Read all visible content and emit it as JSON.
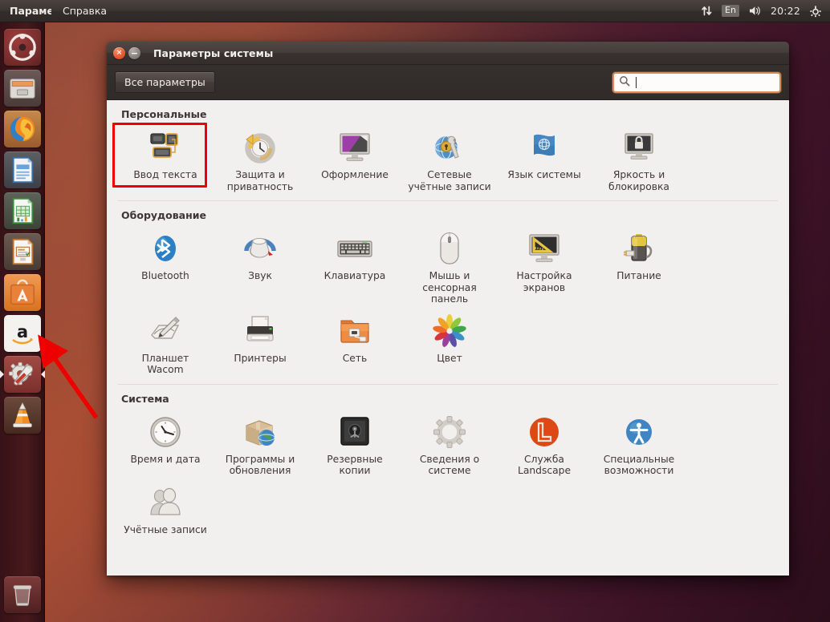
{
  "panel": {
    "menu_app": "Парамет",
    "menu_help": "Справка",
    "network_icon": "network-arrows-icon",
    "keyboard_layout": "En",
    "volume_icon": "volume-icon",
    "clock": "20:22",
    "session_icon": "session-gear-icon"
  },
  "launcher": {
    "items": [
      {
        "name": "dash-home",
        "icon": "ubuntu-logo-icon",
        "state": ""
      },
      {
        "name": "files",
        "icon": "file-manager-icon",
        "state": ""
      },
      {
        "name": "firefox",
        "icon": "firefox-icon",
        "state": ""
      },
      {
        "name": "libreoffice-writer",
        "icon": "writer-icon",
        "state": ""
      },
      {
        "name": "libreoffice-calc",
        "icon": "calc-icon",
        "state": ""
      },
      {
        "name": "libreoffice-impress",
        "icon": "impress-icon",
        "state": ""
      },
      {
        "name": "ubuntu-software-center",
        "icon": "software-center-icon",
        "state": ""
      },
      {
        "name": "amazon",
        "icon": "amazon-icon",
        "state": ""
      },
      {
        "name": "system-settings",
        "icon": "system-settings-icon",
        "state": "active"
      },
      {
        "name": "vlc",
        "icon": "vlc-cone-icon",
        "state": ""
      }
    ],
    "trash": {
      "name": "trash",
      "icon": "trash-icon"
    }
  },
  "window": {
    "title": "Параметры системы",
    "close_label": "×",
    "minimize_label": "−",
    "toolbar": {
      "all_settings_label": "Все параметры",
      "search_placeholder": "",
      "search_value": "",
      "search_icon": "search-icon"
    }
  },
  "sections": [
    {
      "title": "Персональные",
      "tiles": [
        {
          "label": "Ввод текста",
          "icon": "text-entry-icon",
          "highlighted": true
        },
        {
          "label": "Защита и приватность",
          "icon": "privacy-icon",
          "highlighted": false
        },
        {
          "label": "Оформление",
          "icon": "appearance-icon",
          "highlighted": false
        },
        {
          "label": "Сетевые учётные записи",
          "icon": "online-accounts-icon",
          "highlighted": false
        },
        {
          "label": "Язык системы",
          "icon": "language-flag-icon",
          "highlighted": false
        },
        {
          "label": "Яркость и блокировка",
          "icon": "brightness-lock-icon",
          "highlighted": false
        }
      ]
    },
    {
      "title": "Оборудование",
      "tiles": [
        {
          "label": "Bluetooth",
          "icon": "bluetooth-icon",
          "highlighted": false
        },
        {
          "label": "Звук",
          "icon": "sound-icon",
          "highlighted": false
        },
        {
          "label": "Клавиатура",
          "icon": "keyboard-icon",
          "highlighted": false
        },
        {
          "label": "Мышь и сенсорная панель",
          "icon": "mouse-touchpad-icon",
          "highlighted": false
        },
        {
          "label": "Настройка экранов",
          "icon": "displays-icon",
          "highlighted": false
        },
        {
          "label": "Питание",
          "icon": "power-battery-icon",
          "highlighted": false
        },
        {
          "label": "Планшет Wacom",
          "icon": "wacom-tablet-icon",
          "highlighted": false
        },
        {
          "label": "Принтеры",
          "icon": "printer-icon",
          "highlighted": false
        },
        {
          "label": "Сеть",
          "icon": "network-folder-icon",
          "highlighted": false
        },
        {
          "label": "Цвет",
          "icon": "color-wheel-icon",
          "highlighted": false
        }
      ]
    },
    {
      "title": "Система",
      "tiles": [
        {
          "label": "Время и дата",
          "icon": "clock-icon",
          "highlighted": false
        },
        {
          "label": "Программы и обновления",
          "icon": "software-updates-icon",
          "highlighted": false
        },
        {
          "label": "Резервные копии",
          "icon": "backup-safe-icon",
          "highlighted": false
        },
        {
          "label": "Сведения о системе",
          "icon": "system-info-gear-icon",
          "highlighted": false
        },
        {
          "label": "Служба Landscape",
          "icon": "landscape-icon",
          "highlighted": false
        },
        {
          "label": "Специальные возможности",
          "icon": "accessibility-icon",
          "highlighted": false
        },
        {
          "label": "Учётные записи",
          "icon": "user-accounts-icon",
          "highlighted": false
        }
      ]
    }
  ],
  "annotations": {
    "highlight_color": "#ee0000",
    "arrow_color": "#ee0000",
    "highlight_target": "Ввод текста",
    "arrow_target": "system-settings"
  }
}
